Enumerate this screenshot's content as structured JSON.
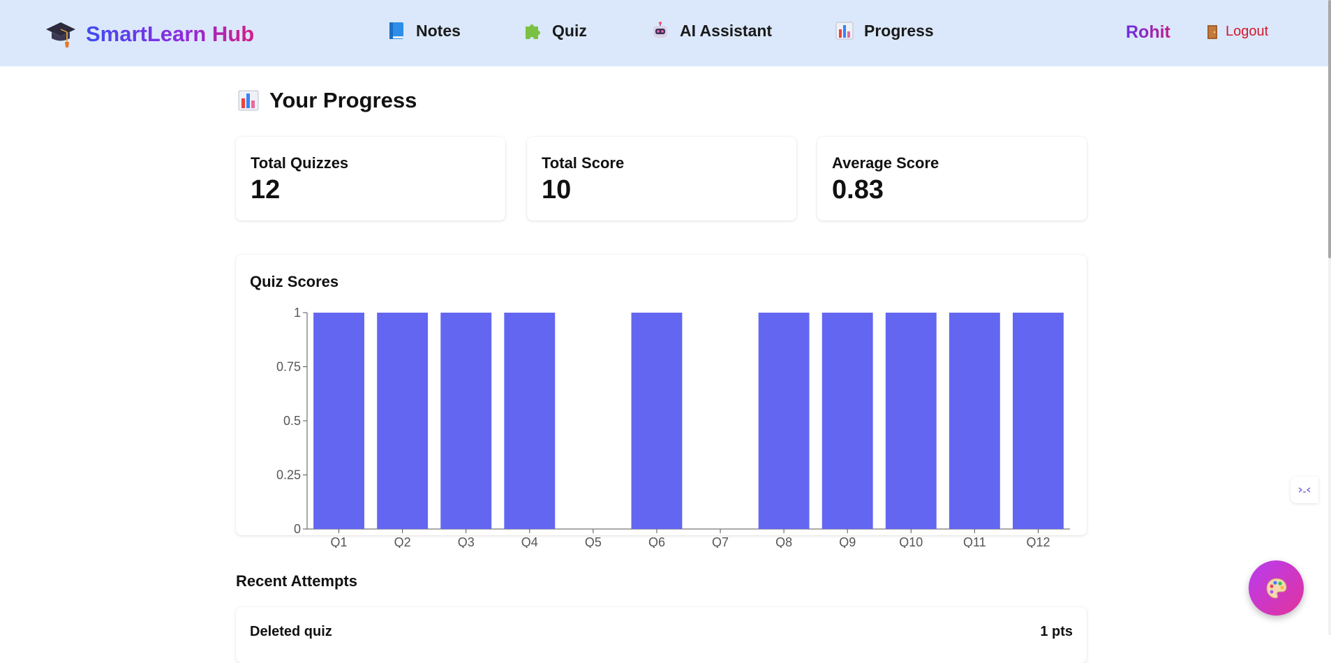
{
  "nav": {
    "brand": "SmartLearn Hub",
    "links": [
      {
        "label": "Notes",
        "icon": "book-icon"
      },
      {
        "label": "Quiz",
        "icon": "puzzle-icon"
      },
      {
        "label": "AI Assistant",
        "icon": "robot-icon"
      },
      {
        "label": "Progress",
        "icon": "bar-chart-icon"
      }
    ],
    "user": "Rohit",
    "logout": "Logout"
  },
  "page": {
    "title": "Your Progress"
  },
  "stats": [
    {
      "label": "Total Quizzes",
      "value": "12"
    },
    {
      "label": "Total Score",
      "value": "10"
    },
    {
      "label": "Average Score",
      "value": "0.83"
    }
  ],
  "chart": {
    "title": "Quiz Scores"
  },
  "chart_data": {
    "type": "bar",
    "title": "Quiz Scores",
    "categories": [
      "Q1",
      "Q2",
      "Q3",
      "Q4",
      "Q5",
      "Q6",
      "Q7",
      "Q8",
      "Q9",
      "Q10",
      "Q11",
      "Q12"
    ],
    "values": [
      1,
      1,
      1,
      1,
      0,
      1,
      0,
      1,
      1,
      1,
      1,
      1
    ],
    "ylim": [
      0,
      1
    ],
    "yticks": [
      "0",
      "0.25",
      "0.5",
      "0.75",
      "1"
    ],
    "xlabel": "",
    "ylabel": "",
    "color": "#6366f1",
    "grid": false
  },
  "recent": {
    "title": "Recent Attempts",
    "items": [
      {
        "name": "Deleted quiz",
        "points": "1 pts"
      }
    ]
  },
  "colors": {
    "nav_bg": "#dbe8fb",
    "bar": "#6366f1",
    "logout": "#d3172c",
    "fab_from": "#b83cf0",
    "fab_to": "#e2339c"
  }
}
